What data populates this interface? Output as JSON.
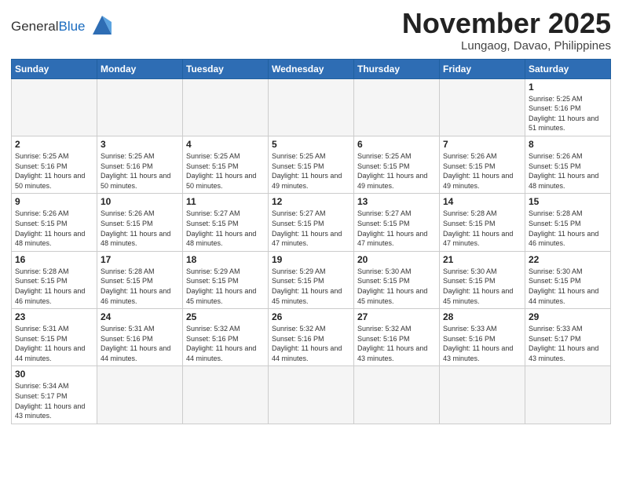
{
  "logo": {
    "general": "General",
    "blue": "Blue"
  },
  "header": {
    "month": "November 2025",
    "location": "Lungaog, Davao, Philippines"
  },
  "weekdays": [
    "Sunday",
    "Monday",
    "Tuesday",
    "Wednesday",
    "Thursday",
    "Friday",
    "Saturday"
  ],
  "weeks": [
    [
      {
        "day": "",
        "empty": true
      },
      {
        "day": "",
        "empty": true
      },
      {
        "day": "",
        "empty": true
      },
      {
        "day": "",
        "empty": true
      },
      {
        "day": "",
        "empty": true
      },
      {
        "day": "",
        "empty": true
      },
      {
        "day": "1",
        "sunrise": "5:25 AM",
        "sunset": "5:16 PM",
        "daylight": "11 hours and 51 minutes."
      }
    ],
    [
      {
        "day": "2",
        "sunrise": "5:25 AM",
        "sunset": "5:16 PM",
        "daylight": "11 hours and 50 minutes."
      },
      {
        "day": "3",
        "sunrise": "5:25 AM",
        "sunset": "5:16 PM",
        "daylight": "11 hours and 50 minutes."
      },
      {
        "day": "4",
        "sunrise": "5:25 AM",
        "sunset": "5:15 PM",
        "daylight": "11 hours and 50 minutes."
      },
      {
        "day": "5",
        "sunrise": "5:25 AM",
        "sunset": "5:15 PM",
        "daylight": "11 hours and 49 minutes."
      },
      {
        "day": "6",
        "sunrise": "5:25 AM",
        "sunset": "5:15 PM",
        "daylight": "11 hours and 49 minutes."
      },
      {
        "day": "7",
        "sunrise": "5:26 AM",
        "sunset": "5:15 PM",
        "daylight": "11 hours and 49 minutes."
      },
      {
        "day": "8",
        "sunrise": "5:26 AM",
        "sunset": "5:15 PM",
        "daylight": "11 hours and 48 minutes."
      }
    ],
    [
      {
        "day": "9",
        "sunrise": "5:26 AM",
        "sunset": "5:15 PM",
        "daylight": "11 hours and 48 minutes."
      },
      {
        "day": "10",
        "sunrise": "5:26 AM",
        "sunset": "5:15 PM",
        "daylight": "11 hours and 48 minutes."
      },
      {
        "day": "11",
        "sunrise": "5:27 AM",
        "sunset": "5:15 PM",
        "daylight": "11 hours and 48 minutes."
      },
      {
        "day": "12",
        "sunrise": "5:27 AM",
        "sunset": "5:15 PM",
        "daylight": "11 hours and 47 minutes."
      },
      {
        "day": "13",
        "sunrise": "5:27 AM",
        "sunset": "5:15 PM",
        "daylight": "11 hours and 47 minutes."
      },
      {
        "day": "14",
        "sunrise": "5:28 AM",
        "sunset": "5:15 PM",
        "daylight": "11 hours and 47 minutes."
      },
      {
        "day": "15",
        "sunrise": "5:28 AM",
        "sunset": "5:15 PM",
        "daylight": "11 hours and 46 minutes."
      }
    ],
    [
      {
        "day": "16",
        "sunrise": "5:28 AM",
        "sunset": "5:15 PM",
        "daylight": "11 hours and 46 minutes."
      },
      {
        "day": "17",
        "sunrise": "5:28 AM",
        "sunset": "5:15 PM",
        "daylight": "11 hours and 46 minutes."
      },
      {
        "day": "18",
        "sunrise": "5:29 AM",
        "sunset": "5:15 PM",
        "daylight": "11 hours and 45 minutes."
      },
      {
        "day": "19",
        "sunrise": "5:29 AM",
        "sunset": "5:15 PM",
        "daylight": "11 hours and 45 minutes."
      },
      {
        "day": "20",
        "sunrise": "5:30 AM",
        "sunset": "5:15 PM",
        "daylight": "11 hours and 45 minutes."
      },
      {
        "day": "21",
        "sunrise": "5:30 AM",
        "sunset": "5:15 PM",
        "daylight": "11 hours and 45 minutes."
      },
      {
        "day": "22",
        "sunrise": "5:30 AM",
        "sunset": "5:15 PM",
        "daylight": "11 hours and 44 minutes."
      }
    ],
    [
      {
        "day": "23",
        "sunrise": "5:31 AM",
        "sunset": "5:15 PM",
        "daylight": "11 hours and 44 minutes."
      },
      {
        "day": "24",
        "sunrise": "5:31 AM",
        "sunset": "5:16 PM",
        "daylight": "11 hours and 44 minutes."
      },
      {
        "day": "25",
        "sunrise": "5:32 AM",
        "sunset": "5:16 PM",
        "daylight": "11 hours and 44 minutes."
      },
      {
        "day": "26",
        "sunrise": "5:32 AM",
        "sunset": "5:16 PM",
        "daylight": "11 hours and 44 minutes."
      },
      {
        "day": "27",
        "sunrise": "5:32 AM",
        "sunset": "5:16 PM",
        "daylight": "11 hours and 43 minutes."
      },
      {
        "day": "28",
        "sunrise": "5:33 AM",
        "sunset": "5:16 PM",
        "daylight": "11 hours and 43 minutes."
      },
      {
        "day": "29",
        "sunrise": "5:33 AM",
        "sunset": "5:17 PM",
        "daylight": "11 hours and 43 minutes."
      }
    ],
    [
      {
        "day": "30",
        "sunrise": "5:34 AM",
        "sunset": "5:17 PM",
        "daylight": "11 hours and 43 minutes."
      },
      {
        "day": "",
        "empty": true
      },
      {
        "day": "",
        "empty": true
      },
      {
        "day": "",
        "empty": true
      },
      {
        "day": "",
        "empty": true
      },
      {
        "day": "",
        "empty": true
      },
      {
        "day": "",
        "empty": true
      }
    ]
  ]
}
